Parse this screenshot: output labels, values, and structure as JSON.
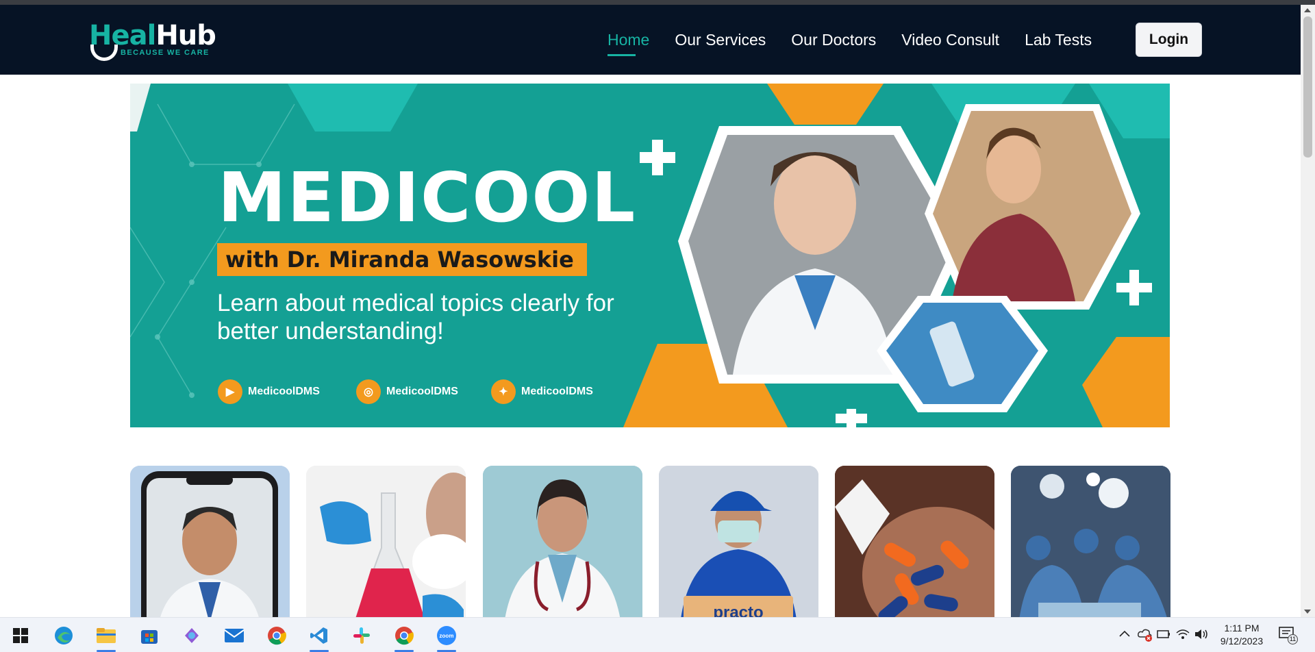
{
  "brand": {
    "name_part1": "Heal",
    "name_part2": "Hub",
    "tagline": "BECAUSE WE CARE"
  },
  "nav": {
    "items": [
      {
        "label": "Home",
        "active": true
      },
      {
        "label": "Our Services",
        "active": false
      },
      {
        "label": "Our Doctors",
        "active": false
      },
      {
        "label": "Video Consult",
        "active": false
      },
      {
        "label": "Lab Tests",
        "active": false
      }
    ],
    "login_label": "Login"
  },
  "banner": {
    "title": "MEDICOOL",
    "subtitle": "with Dr. Miranda Wasowskie",
    "description": "Learn about medical topics clearly for better understanding!",
    "socials": [
      {
        "platform": "youtube-icon",
        "handle": "MedicoolDMS"
      },
      {
        "platform": "instagram-icon",
        "handle": "MedicoolDMS"
      },
      {
        "platform": "twitter-icon",
        "handle": "MedicoolDMS"
      }
    ],
    "colors": {
      "teal": "#14a094",
      "orange": "#f39a1e"
    }
  },
  "service_cards": [
    {
      "image": "video-consult-doctor-photo"
    },
    {
      "image": "lab-test-flask-photo"
    },
    {
      "image": "female-doctor-photo"
    },
    {
      "image": "delivery-person-photo"
    },
    {
      "image": "medicine-capsules-photo"
    },
    {
      "image": "surgery-team-photo"
    }
  ],
  "taskbar": {
    "apps": [
      "windows-start-icon",
      "edge-icon",
      "file-explorer-icon",
      "store-icon",
      "copilot-icon",
      "mail-icon",
      "chrome-icon",
      "vscode-icon",
      "slack-icon",
      "chrome-icon",
      "zoom-icon"
    ],
    "time": "1:11 PM",
    "date": "9/12/2023",
    "notification_count": "11"
  }
}
